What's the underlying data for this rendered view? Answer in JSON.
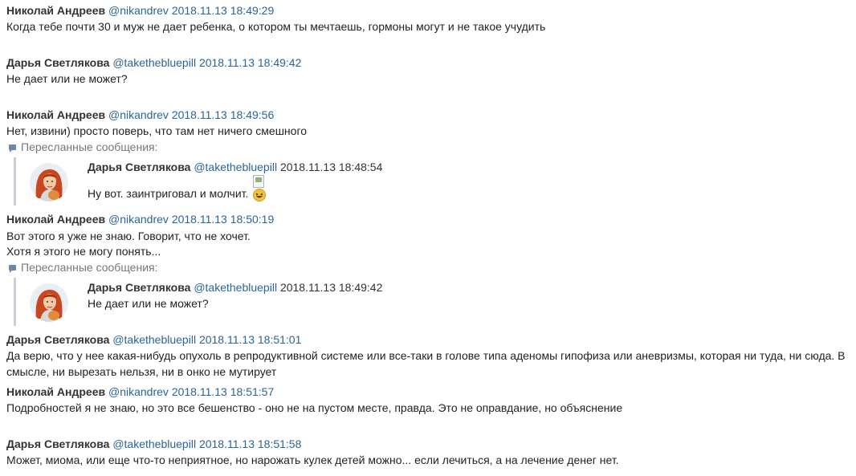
{
  "forwarded_label": "Пересланные сообщения:",
  "messages": [
    {
      "author": "Николай Андреев",
      "handle": "@nikandrev",
      "time": "2018.11.13 18:49:29",
      "text": "Когда тебе почти 30 и муж не дает ребенка, о котором ты мечтаешь, гормоны могут и не такое учудить"
    },
    {
      "author": "Дарья Светлякова",
      "handle": "@takethebluepill",
      "time": "2018.11.13 18:49:42",
      "text": "Не дает или не может?"
    },
    {
      "author": "Николай Андреев",
      "handle": "@nikandrev",
      "time": "2018.11.13 18:49:56",
      "text": "Нет, извини) просто поверь, что там нет ничего смешного",
      "forwarded": {
        "author": "Дарья Светлякова",
        "handle": "@takethebluepill",
        "time": "2018.11.13 18:48:54",
        "text": "Ну вот. заинтриговал и молчит."
      }
    },
    {
      "author": "Николай Андреев",
      "handle": "@nikandrev",
      "time": "2018.11.13 18:50:19",
      "lines": [
        "Вот этого я уже не знаю. Говорит, что не хочет.",
        "Хотя я этого не могу понять..."
      ],
      "forwarded": {
        "author": "Дарья Светлякова",
        "handle": "@takethebluepill",
        "time": "2018.11.13 18:49:42",
        "text": "Не дает или не может?"
      }
    },
    {
      "author": "Дарья Светлякова",
      "handle": "@takethebluepill",
      "time": "2018.11.13 18:51:01",
      "text": "Да верю, что у нее какая-нибудь опухоль в репродуктивной системе или все-таки в голове типа аденомы гипофиза или аневризмы, которая ни туда, ни сюда. В смысле, ни вырезать нельзя, ни в онко не мутирует"
    },
    {
      "author": "Николай Андреев",
      "handle": "@nikandrev",
      "time": "2018.11.13 18:51:57",
      "text": "Подробностей я не знаю, но это все бешенство - оно не на пустом месте, правда. Это не оправдание, но объяснение"
    },
    {
      "author": "Дарья Светлякова",
      "handle": "@takethebluepill",
      "time": "2018.11.13 18:51:58",
      "text": "Может, миома, или еще что-то неприятное, но нарожать кулек детей можно... если лечиться, а на лечение денег нет."
    }
  ]
}
